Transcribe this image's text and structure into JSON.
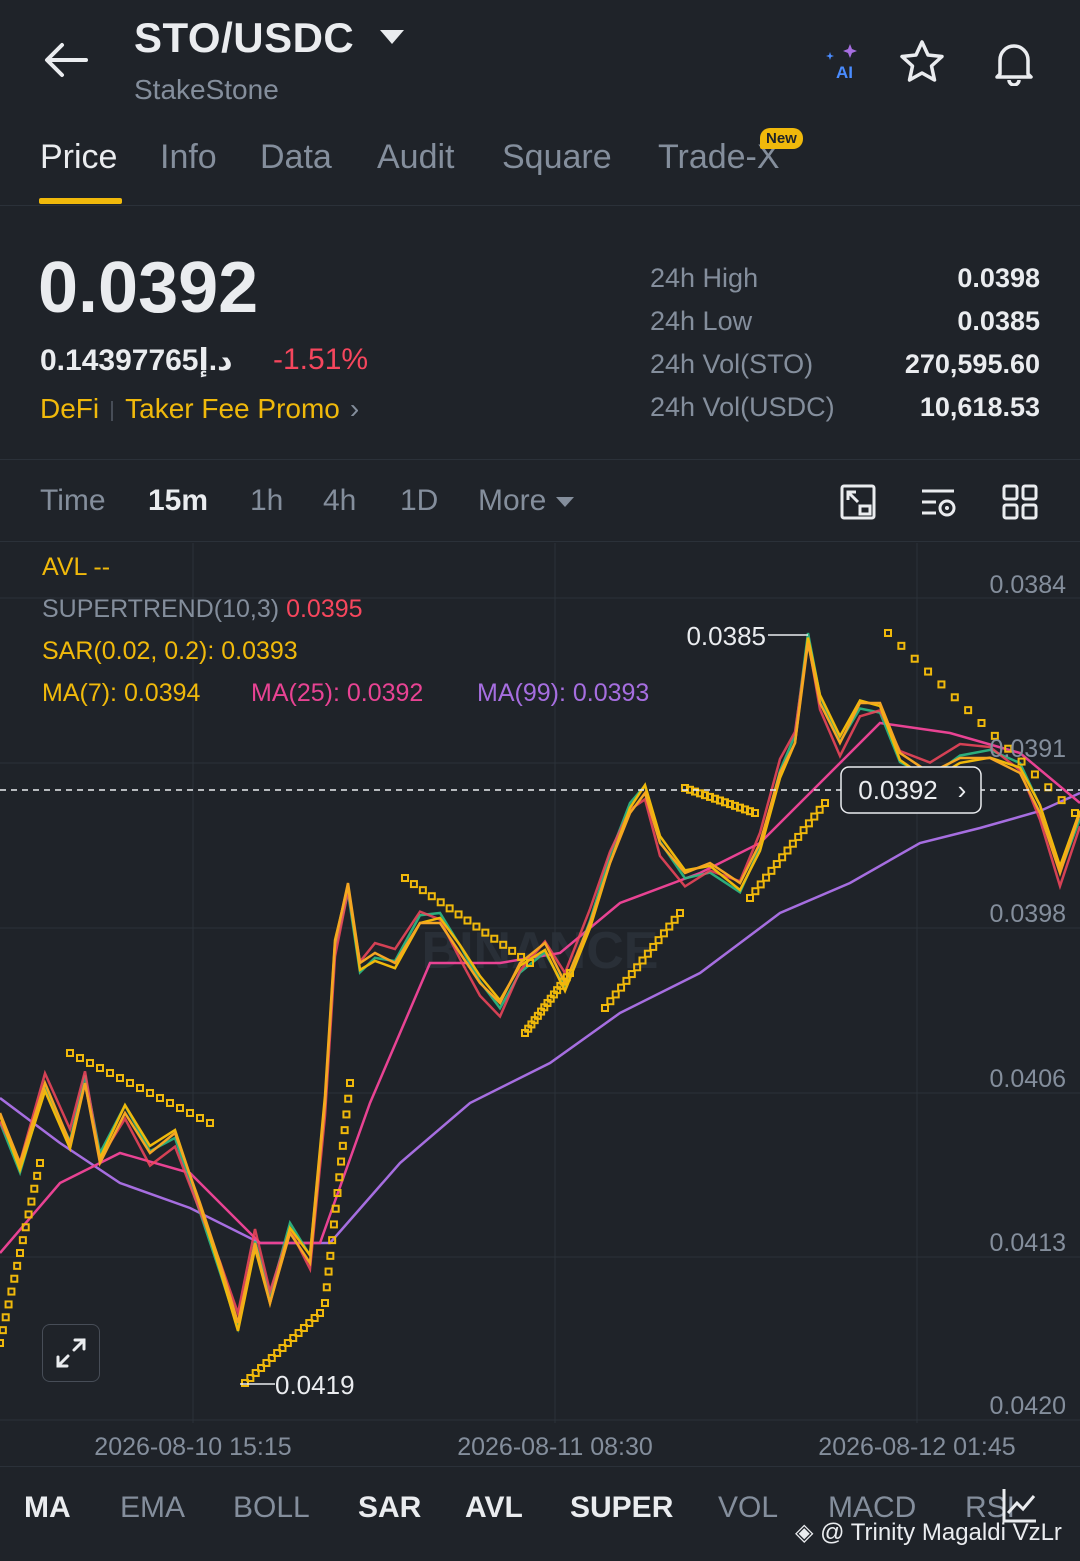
{
  "header": {
    "pair": "STO/USDC",
    "subtitle": "StakeStone",
    "icons": [
      "back-arrow-icon",
      "ai-icon",
      "star-icon",
      "bell-icon"
    ]
  },
  "tabs": [
    {
      "label": "Price",
      "active": true
    },
    {
      "label": "Info"
    },
    {
      "label": "Data"
    },
    {
      "label": "Audit"
    },
    {
      "label": "Square"
    },
    {
      "label": "Trade-X",
      "badge": "New"
    }
  ],
  "price": {
    "last": "0.0392",
    "fiat": "0.14397765د.إ",
    "change": "-1.51%",
    "tag1": "DeFi",
    "tag2": "Taker Fee Promo",
    "stats": [
      {
        "label": "24h High",
        "value": "0.0398"
      },
      {
        "label": "24h Low",
        "value": "0.0385"
      },
      {
        "label": "24h Vol(STO)",
        "value": "270,595.60"
      },
      {
        "label": "24h Vol(USDC)",
        "value": "10,618.53"
      }
    ]
  },
  "intervals": {
    "items": [
      "Time",
      "15m",
      "1h",
      "4h",
      "1D",
      "More"
    ],
    "active": "15m"
  },
  "indicators": {
    "avl": "AVL --",
    "supertrend_label": "SUPERTREND(10,3)",
    "supertrend_value": "0.0395",
    "sar": "SAR(0.02, 0.2): 0.0393",
    "ma7": "MA(7): 0.0394",
    "ma25": "MA(25): 0.0392",
    "ma99": "MA(99): 0.0393"
  },
  "chart_data": {
    "type": "line",
    "y_axis_ticks": [
      "0.0384",
      "0.0391",
      "0.0398",
      "0.0406",
      "0.0413",
      "0.0420"
    ],
    "x_axis_ticks": [
      "2026-08-10 15:15",
      "2026-08-11 08:30",
      "2026-08-12 01:45"
    ],
    "current_price_label": "0.0392",
    "high_marker": "0.0385",
    "low_marker": "0.0419",
    "series": [
      {
        "name": "MA(7)",
        "color": "#f0b90b"
      },
      {
        "name": "MA(25)",
        "color": "#e84393"
      },
      {
        "name": "MA(99)",
        "color": "#a66ee0"
      }
    ],
    "watermark": "BINANCE"
  },
  "indicator_tabs": [
    {
      "label": "MA",
      "on": true
    },
    {
      "label": "EMA"
    },
    {
      "label": "BOLL"
    },
    {
      "label": "SAR",
      "on": true
    },
    {
      "label": "AVL",
      "on": true
    },
    {
      "label": "SUPER",
      "on": true
    },
    {
      "label": "VOL"
    },
    {
      "label": "MACD"
    },
    {
      "label": "RSI"
    }
  ],
  "watermark_credit": "@ Trinity Magaldi VzLr",
  "colors": {
    "bg": "#1f2329",
    "accent": "#f0b90b",
    "down": "#f6465d",
    "up": "#2ebd85",
    "muted": "#848e9c"
  }
}
